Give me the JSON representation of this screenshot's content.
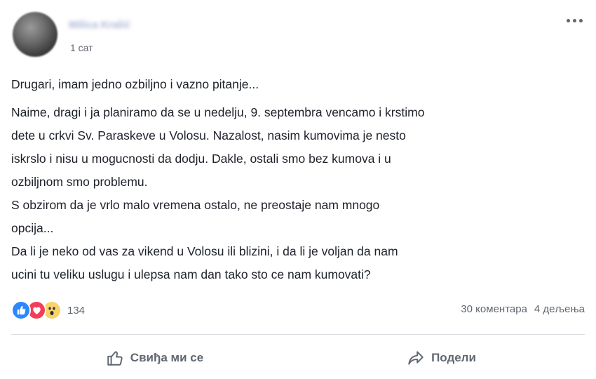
{
  "post": {
    "author_name": "Milica Kralić",
    "timestamp": "1 сат",
    "body": {
      "intro": "Drugari, imam jedno ozbiljno i vazno pitanje...",
      "paragraph1": "Naime, dragi i ja planiramo da se u nedelju, 9. septembra vencamo i krstimo\ndete u crkvi Sv. Paraskeve u Volosu. Nazalost, nasim kumovima je nesto\niskrslo i nisu u mogucnosti da dodju. Dakle, ostali smo bez kumova i u\nozbiljnom smo problemu.",
      "paragraph2": "S obzirom da je vrlo malo vremena ostalo, ne preostaje nam mnogo\nopcija...",
      "paragraph3": "Da li je neko od vas za vikend u Volosu ili blizini, i da li je voljan da nam\nucini tu veliku uslugu i ulepsa nam dan tako sto ce nam kumovati?"
    }
  },
  "reactions": {
    "icons": [
      "like-icon",
      "love-icon",
      "wow-icon"
    ],
    "count": "134"
  },
  "engagement": {
    "comments": "30 коментара",
    "shares": "4 дељења"
  },
  "actions": {
    "like_label": "Свиђа ми се",
    "share_label": "Подели"
  },
  "colors": {
    "like": "#2d88ff",
    "love": "#f33e58",
    "wow": "#f7d36b",
    "secondary_text": "#606770"
  }
}
